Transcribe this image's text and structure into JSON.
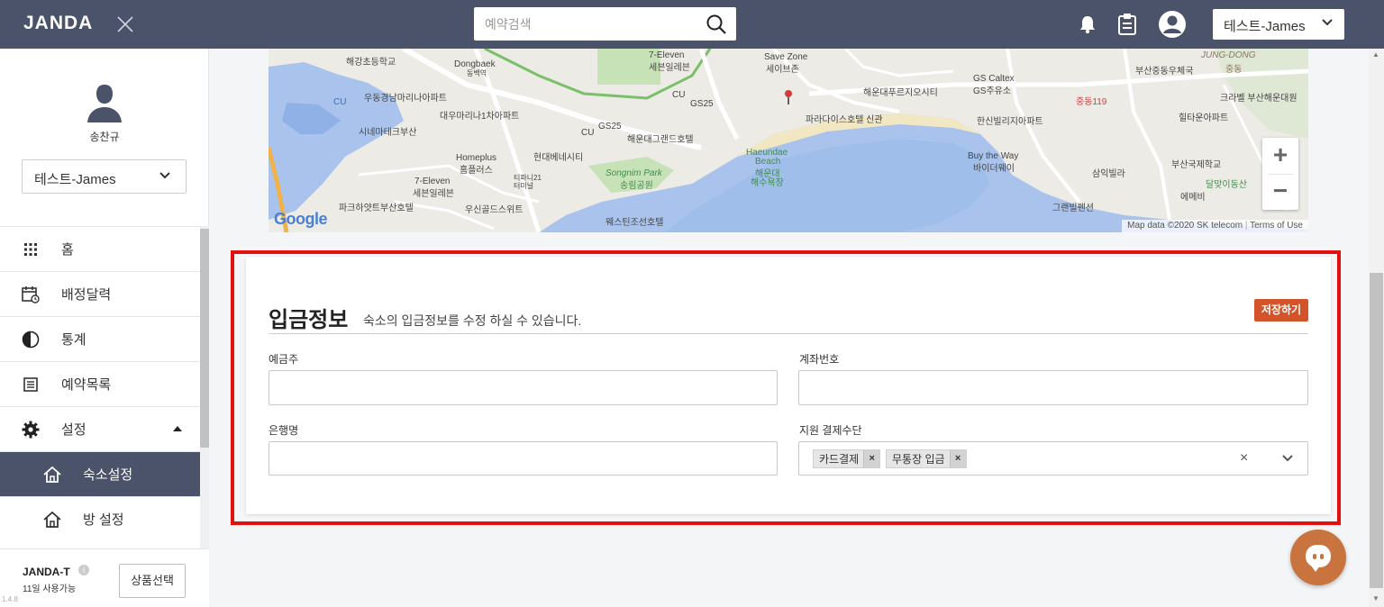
{
  "topbar": {
    "logo": "JANDA",
    "search_placeholder": "예약검색",
    "user_select": "테스트-James"
  },
  "sidebar": {
    "profile_name": "송찬규",
    "property_select": "테스트-James",
    "menu": [
      {
        "label": "홈",
        "icon": "grid-icon"
      },
      {
        "label": "배정달력",
        "icon": "calendar-icon"
      },
      {
        "label": "통계",
        "icon": "pie-chart-icon"
      },
      {
        "label": "예약목록",
        "icon": "list-icon"
      },
      {
        "label": "설정",
        "icon": "gear-icon"
      },
      {
        "label": "숙소설정",
        "icon": "home-icon",
        "active": true
      },
      {
        "label": "방 설정",
        "icon": "house-outline-icon"
      }
    ],
    "plan": {
      "name": "JANDA-T",
      "info": "i",
      "days": "11일 사용가능",
      "button": "상품선택"
    },
    "version": "1.4.8"
  },
  "map": {
    "labels": [
      "해강초등학교",
      "우동경남마리나아파트",
      "CU",
      "대우마리나1차아파트",
      "시네마테크부산",
      "Dongbaek",
      "동백역",
      "7-Eleven",
      "세븐일레븐",
      "Save Zone",
      "세이브존",
      "CU",
      "GS25",
      "GS25",
      "CU",
      "해운대그랜드호텔",
      "현대베네시티",
      "Homeplus",
      "홈플러스",
      "7-Eleven",
      "세븐일레븐",
      "티파니21",
      "터미널",
      "Songnim Park",
      "송림공원",
      "Haeundae",
      "Beach",
      "해운대",
      "해수욕장",
      "파크하얏트부산호텔",
      "우신골드스위트",
      "웨스틴조선호텔",
      "해운대푸르지오시티",
      "GS Caltex",
      "GS주유소",
      "파라다이스호텔 신관",
      "한신빌리지아파트",
      "Buy the Way",
      "바이더웨이",
      "삼익빌라",
      "그랜빌펜션",
      "부산중동우체국",
      "JUNG-DONG",
      "중동",
      "중동119",
      "크라벨 부산해운대원",
      "힐타운아파트",
      "부산국제학교",
      "달맞이동산",
      "에메비"
    ],
    "google_logo": "Google",
    "attribution": "Map data ©2020 SK telecom",
    "terms": "Terms of Use",
    "zoom_in": "+",
    "zoom_out": "−"
  },
  "section": {
    "title": "입금정보",
    "description": "숙소의 입금정보를 수정 하실 수 있습니다.",
    "save_button": "저장하기",
    "fields": {
      "depositor_label": "예금주",
      "depositor_value": "",
      "account_label": "계좌번호",
      "account_value": "",
      "bank_label": "은행명",
      "bank_value": "",
      "payment_label": "지원 결제수단",
      "payment_tags": [
        "카드결제",
        "무통장 입금"
      ],
      "tag_remove": "×",
      "clear": "×"
    }
  },
  "colors": {
    "topbar": "#4a5369",
    "accent": "#d3542b",
    "highlight": "#e31010",
    "chat": "#c9743f"
  }
}
